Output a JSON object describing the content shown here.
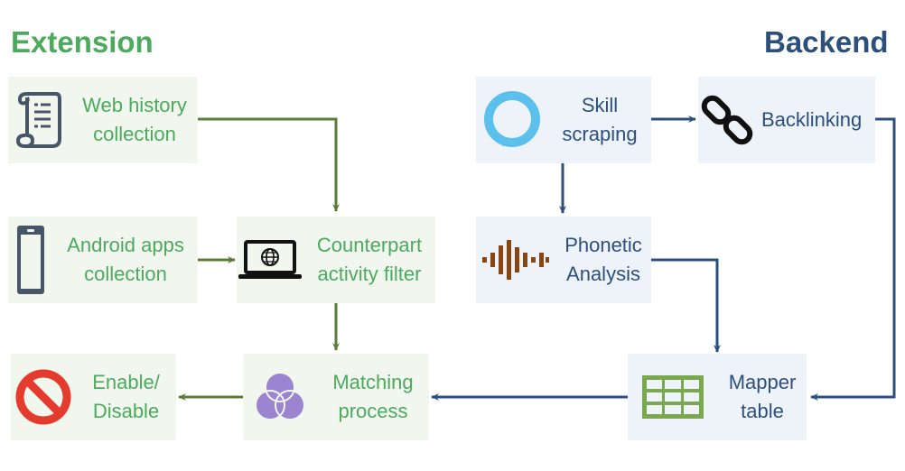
{
  "sections": {
    "extension": "Extension",
    "backend": "Backend"
  },
  "colors": {
    "extension_green": "#4caa5e",
    "backend_blue": "#2d4f7c",
    "arrow_green": "#5a7e3a",
    "arrow_blue": "#2d4f7c"
  },
  "nodes": {
    "web_history": {
      "line1": "Web history",
      "line2": "collection",
      "icon": "scroll-icon"
    },
    "android_apps": {
      "line1": "Android apps",
      "line2": "collection",
      "icon": "smartphone-icon"
    },
    "counterpart_filter": {
      "line1": "Counterpart",
      "line2": "activity filter",
      "icon": "laptop-globe-icon"
    },
    "matching": {
      "line1": "Matching",
      "line2": "process",
      "icon": "venn-diagram-icon"
    },
    "enable_disable": {
      "line1": "Enable/",
      "line2": "Disable",
      "icon": "prohibited-icon"
    },
    "skill_scraping": {
      "line1": "Skill",
      "line2": "scraping",
      "icon": "alexa-ring-icon"
    },
    "backlinking": {
      "line1": "Backlinking",
      "line2": "",
      "icon": "chain-link-icon"
    },
    "phonetic": {
      "line1": "Phonetic",
      "line2": "Analysis",
      "icon": "soundwave-icon"
    },
    "mapper": {
      "line1": "Mapper",
      "line2": "table",
      "icon": "table-grid-icon"
    }
  },
  "edges": [
    {
      "from": "web_history",
      "to": "counterpart_filter"
    },
    {
      "from": "android_apps",
      "to": "counterpart_filter"
    },
    {
      "from": "counterpart_filter",
      "to": "matching"
    },
    {
      "from": "matching",
      "to": "enable_disable"
    },
    {
      "from": "skill_scraping",
      "to": "backlinking"
    },
    {
      "from": "skill_scraping",
      "to": "phonetic"
    },
    {
      "from": "phonetic",
      "to": "mapper"
    },
    {
      "from": "backlinking",
      "to": "mapper"
    },
    {
      "from": "mapper",
      "to": "matching"
    }
  ]
}
